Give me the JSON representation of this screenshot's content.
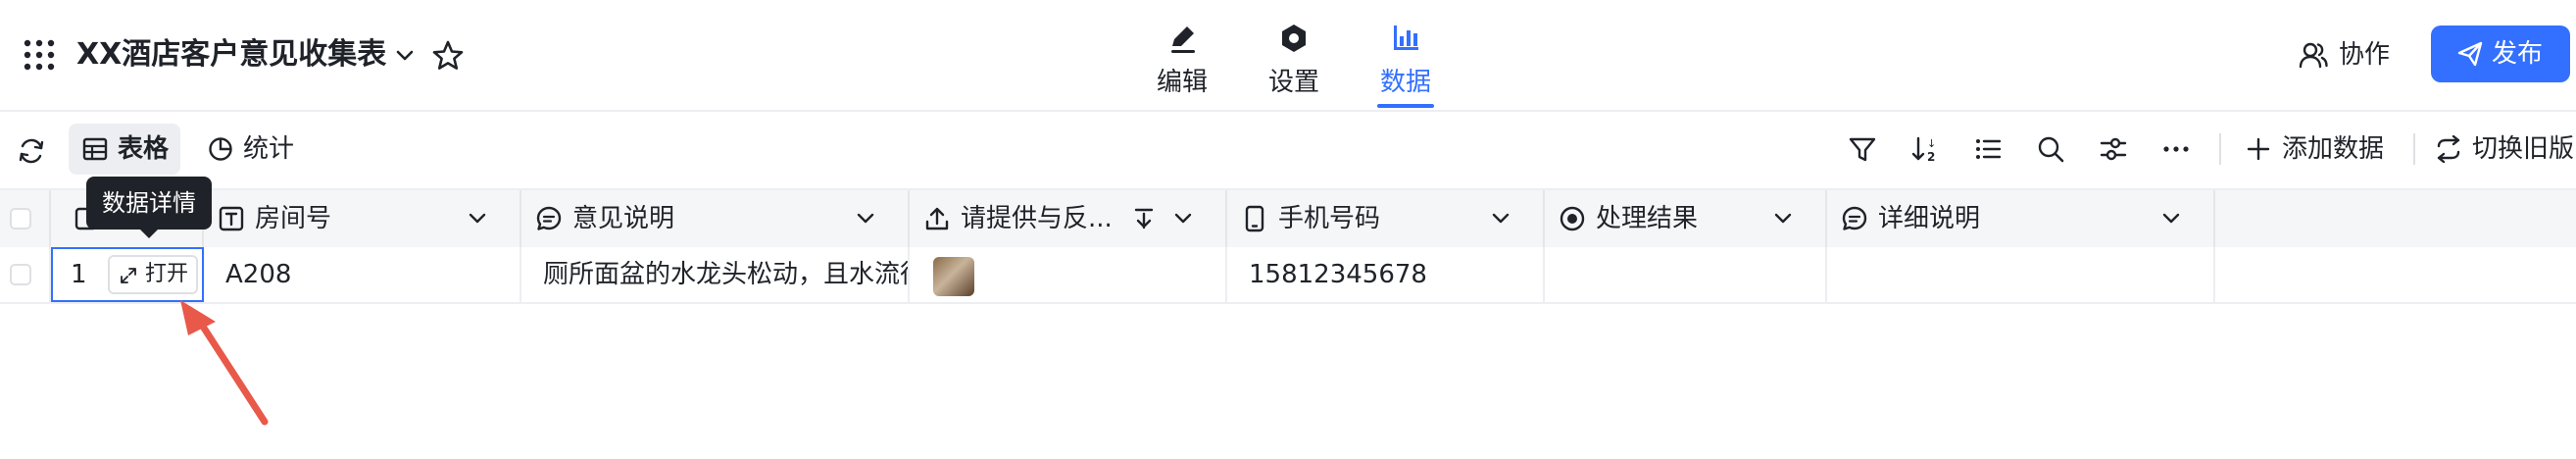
{
  "header": {
    "title": "XX酒店客户意见收集表",
    "tabs": [
      {
        "label": "编辑",
        "icon": "pen-icon"
      },
      {
        "label": "设置",
        "icon": "hexagon-gear-icon"
      },
      {
        "label": "数据",
        "icon": "bar-chart-icon",
        "active": true
      }
    ],
    "collab_label": "协作",
    "publish_label": "发布"
  },
  "toolbar": {
    "views": [
      {
        "label": "表格",
        "icon": "table-icon",
        "active": true
      },
      {
        "label": "统计",
        "icon": "pie-chart-icon"
      }
    ],
    "actions": [
      "filter-icon",
      "sort-icon",
      "list-icon",
      "search-icon",
      "adjust-icon",
      "more-icon"
    ],
    "add_data_label": "添加数据",
    "old_version_label": "切换旧版"
  },
  "table": {
    "columns": [
      {
        "label": "房间号",
        "icon": "text-field-icon"
      },
      {
        "label": "意见说明",
        "icon": "comment-icon"
      },
      {
        "label": "请提供与反...",
        "icon": "upload-icon"
      },
      {
        "label": "手机号码",
        "icon": "phone-icon"
      },
      {
        "label": "处理结果",
        "icon": "radio-icon"
      },
      {
        "label": "详细说明",
        "icon": "comment-icon"
      }
    ],
    "rows": [
      {
        "index": "1",
        "open_label": "打开",
        "room": "A208",
        "opinion": "厕所面盆的水龙头松动，且水流很",
        "attachment": "image-thumbnail",
        "phone": "15812345678",
        "result": "",
        "detail": ""
      }
    ],
    "tooltip": "数据详情"
  },
  "colors": {
    "accent": "#3370ff",
    "annotation_arrow": "#e8594a"
  }
}
